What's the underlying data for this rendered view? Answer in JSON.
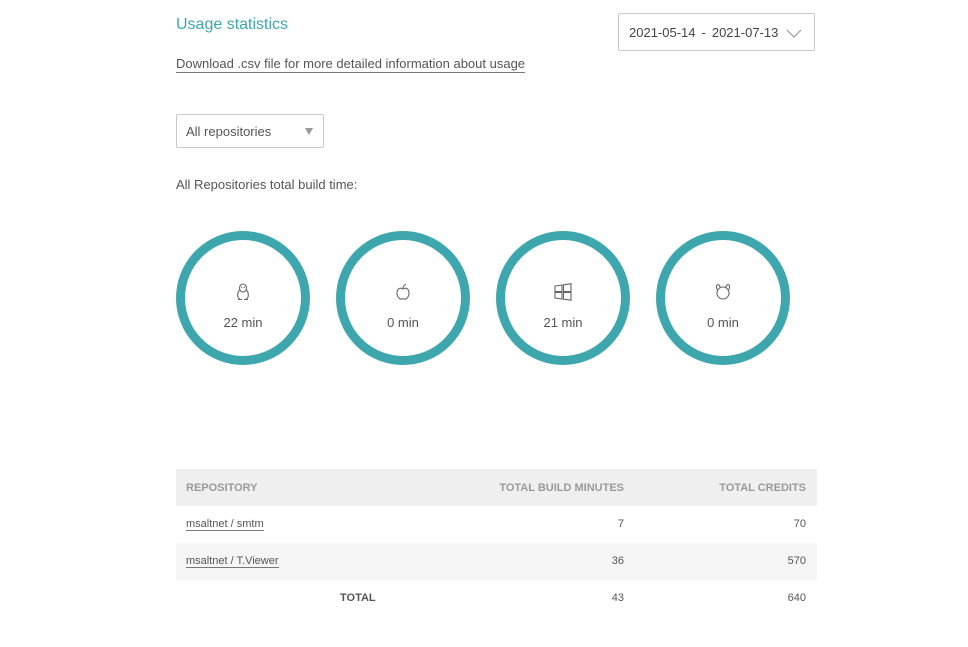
{
  "header": {
    "title": "Usage statistics",
    "csv_link": "Download .csv file for more detailed information about usage"
  },
  "date_range": {
    "start": "2021-05-14",
    "separator": "-",
    "end": "2021-07-13"
  },
  "filter": {
    "selected": "All repositories"
  },
  "build_time_label": "All Repositories total build time:",
  "build_times": [
    {
      "icon": "linux-icon",
      "value": "22 min"
    },
    {
      "icon": "apple-icon",
      "value": "0 min"
    },
    {
      "icon": "windows-icon",
      "value": "21 min"
    },
    {
      "icon": "freebsd-icon",
      "value": "0 min"
    }
  ],
  "table": {
    "headers": {
      "repository": "REPOSITORY",
      "minutes": "TOTAL BUILD MINUTES",
      "credits": "TOTAL CREDITS"
    },
    "rows": [
      {
        "repository": "msaltnet / smtm",
        "minutes": "7",
        "credits": "70"
      },
      {
        "repository": "msaltnet / T.Viewer",
        "minutes": "36",
        "credits": "570"
      }
    ],
    "total": {
      "label": "TOTAL",
      "minutes": "43",
      "credits": "640"
    }
  },
  "colors": {
    "accent": "#3ea6ad",
    "header_bg": "#efefef"
  }
}
